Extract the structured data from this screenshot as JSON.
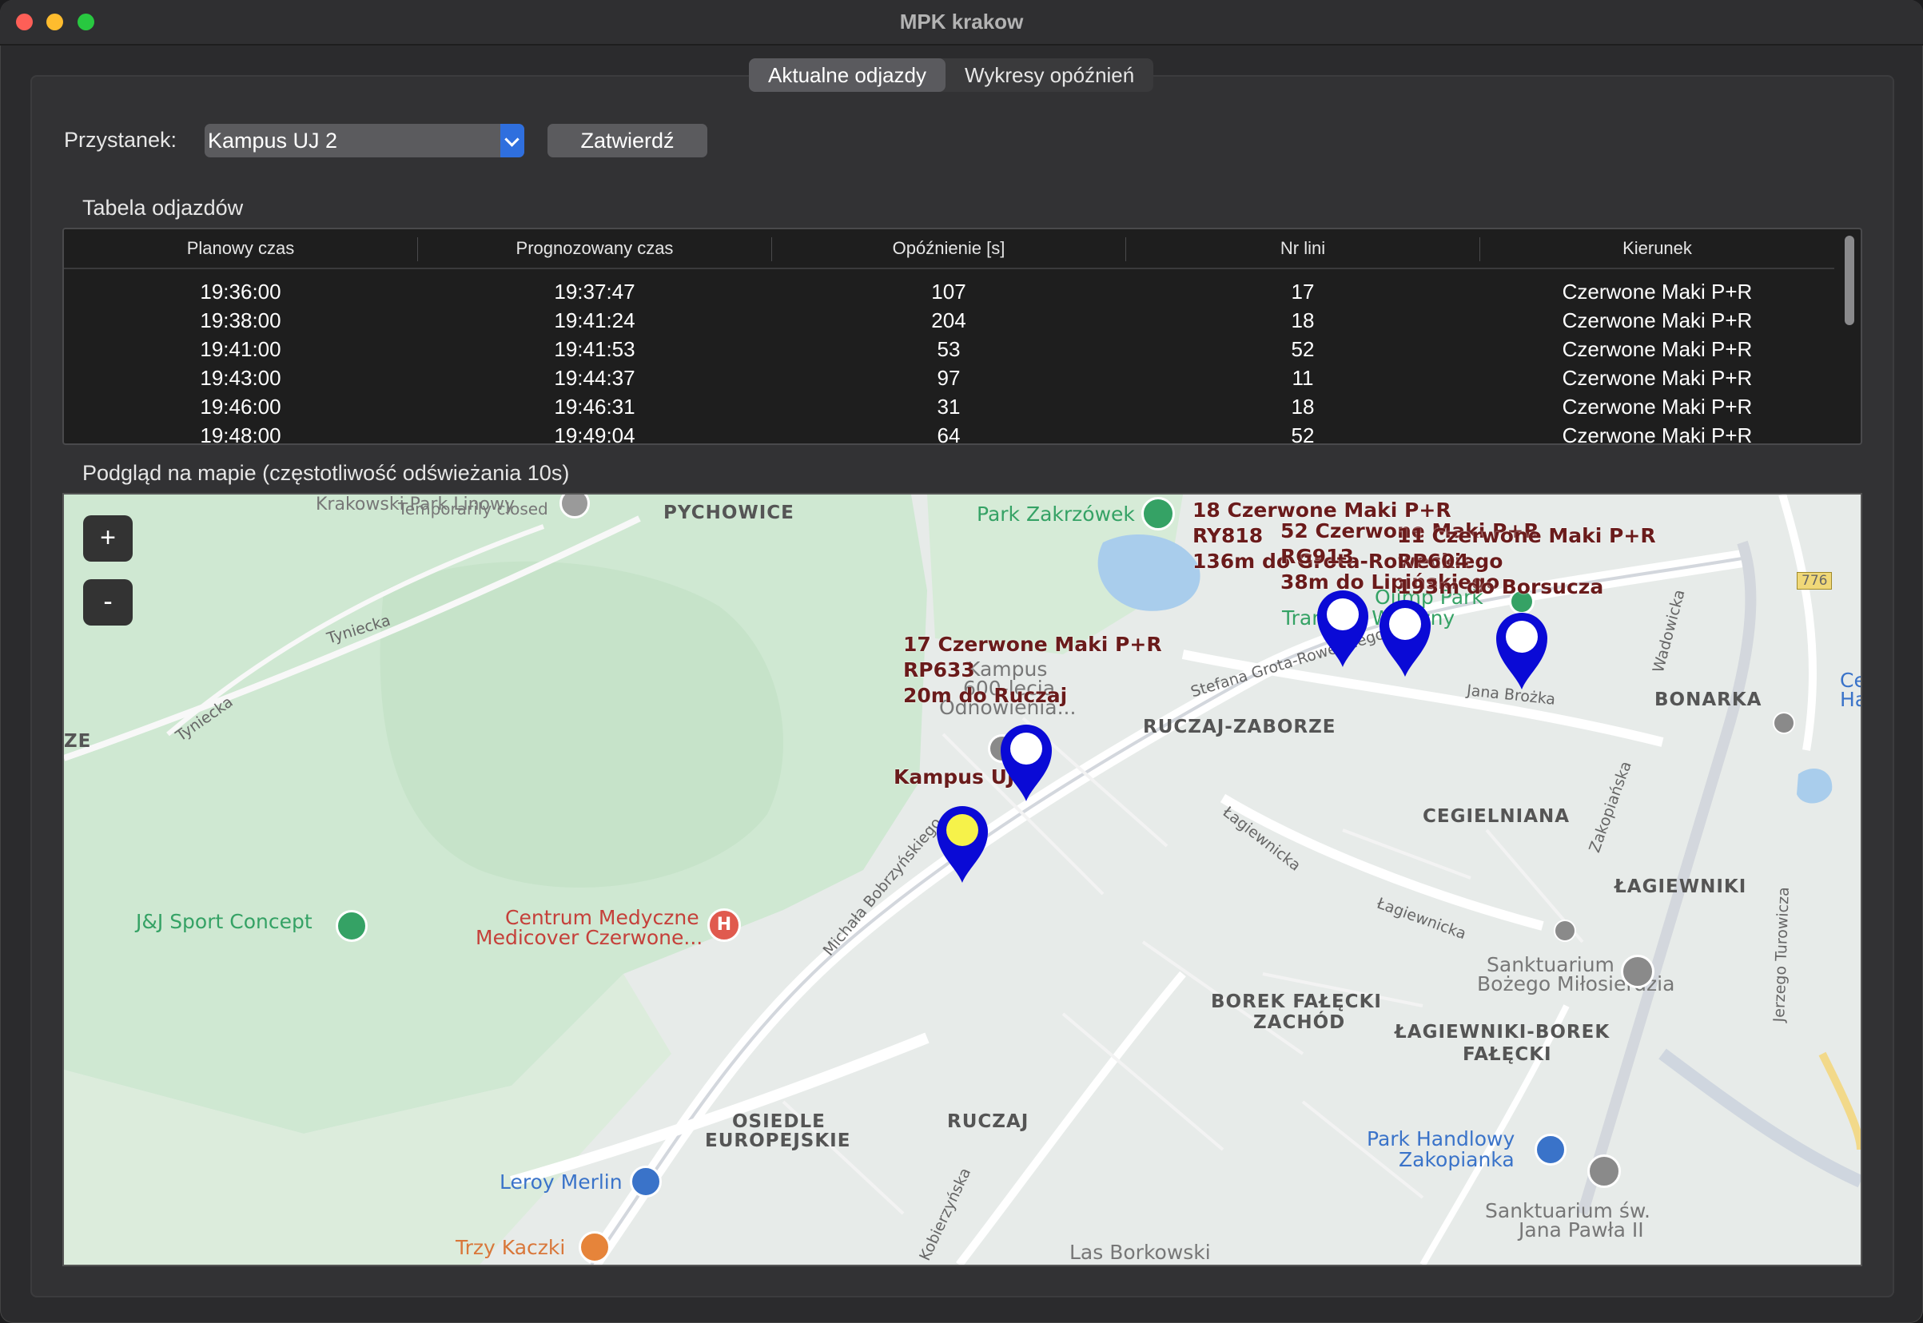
{
  "window": {
    "title": "MPK krakow"
  },
  "tabs": [
    {
      "label": "Aktualne odjazdy",
      "active": true
    },
    {
      "label": "Wykresy opóźnień",
      "active": false
    }
  ],
  "stop": {
    "label": "Przystanek:",
    "selected": "Kampus UJ 2",
    "confirm_label": "Zatwierdź"
  },
  "table": {
    "section_label": "Tabela odjazdów",
    "columns": [
      "Planowy czas",
      "Prognozowany czas",
      "Opóźnienie [s]",
      "Nr lini",
      "Kierunek"
    ],
    "rows": [
      [
        "19:36:00",
        "19:37:47",
        "107",
        "17",
        "Czerwone Maki P+R"
      ],
      [
        "19:38:00",
        "19:41:24",
        "204",
        "18",
        "Czerwone Maki P+R"
      ],
      [
        "19:41:00",
        "19:41:53",
        "53",
        "52",
        "Czerwone Maki P+R"
      ],
      [
        "19:43:00",
        "19:44:37",
        "97",
        "11",
        "Czerwone Maki P+R"
      ],
      [
        "19:46:00",
        "19:46:31",
        "31",
        "18",
        "Czerwone Maki P+R"
      ],
      [
        "19:48:00",
        "19:49:04",
        "64",
        "52",
        "Czerwone Maki P+R"
      ]
    ]
  },
  "map": {
    "section_label": "Podgląd na mapie (częstotliwość odświeżania 10s)",
    "zoom_in": "+",
    "zoom_out": "-",
    "stop_marker_label": "Kampus UJ 2",
    "vehicle_labels": [
      [
        "17 Czerwone Maki P+R",
        "RP633",
        "20m do Ruczaj"
      ],
      [
        "18 Czerwone Maki P+R",
        "RY818",
        "136m do Grota-Roweckiego"
      ],
      [
        "52 Czerwone Maki P+R",
        "RG913",
        "38m do Lipińskiego"
      ],
      [
        "11 Czerwone Maki P+R",
        "RP604",
        "193m do Borsucza"
      ]
    ],
    "districts": [
      "PYCHOWICE",
      "RUCZAJ-ZABORZE",
      "BONARKA",
      "CEGIELNIANA",
      "ŁAGIEWNIKI",
      "BOREK FAŁĘCKI",
      "ZACHÓD",
      "ŁAGIEWNIKI-BOREK",
      "FAŁĘCKI",
      "OSIEDLE",
      "EUROPEJSKIE",
      "RUCZAJ",
      "ZE"
    ],
    "streets": [
      "Tyniecka",
      "Tyniecka",
      "Stefana Grota-Roweckiego",
      "Jana Brożka",
      "Łagiewnicka",
      "Łagiewnicka",
      "Zakopiańska",
      "Wadowicka",
      "Michała Bobrzyńskiego",
      "Kobierzyńska",
      "Jerzego Turowicza",
      "776"
    ],
    "pois": {
      "park_zakrzowek": "Park Zakrzówek",
      "temporarily_closed": "Temporarily closed",
      "krakowski_park": "Krakowski Park Linowy",
      "kampus_a": "Kampus",
      "kampus_b": "600-lecia",
      "kampus_c": "Odnowienia...",
      "jj_sport": "J&J Sport Concept",
      "medicover_a": "Centrum Medyczne",
      "medicover_b": "Medicover Czerwone...",
      "sanktuarium_a": "Sanktuarium",
      "sanktuarium_b": "Bożego Miłosierdzia",
      "park_handlowy_a": "Park Handlowy",
      "park_handlowy_b": "Zakopianka",
      "leroy": "Leroy Merlin",
      "trzy_kaczki": "Trzy Kaczki",
      "las_borkowski": "Las Borkowski",
      "jpawla_a": "Sanktuarium św.",
      "jpawla_b": "Jana Pawła II",
      "olimp_a": "Olimp Park",
      "tram_a": "Tramwaj Wieczny",
      "edge_ce": "Ce",
      "edge_ha": "Ha"
    }
  }
}
